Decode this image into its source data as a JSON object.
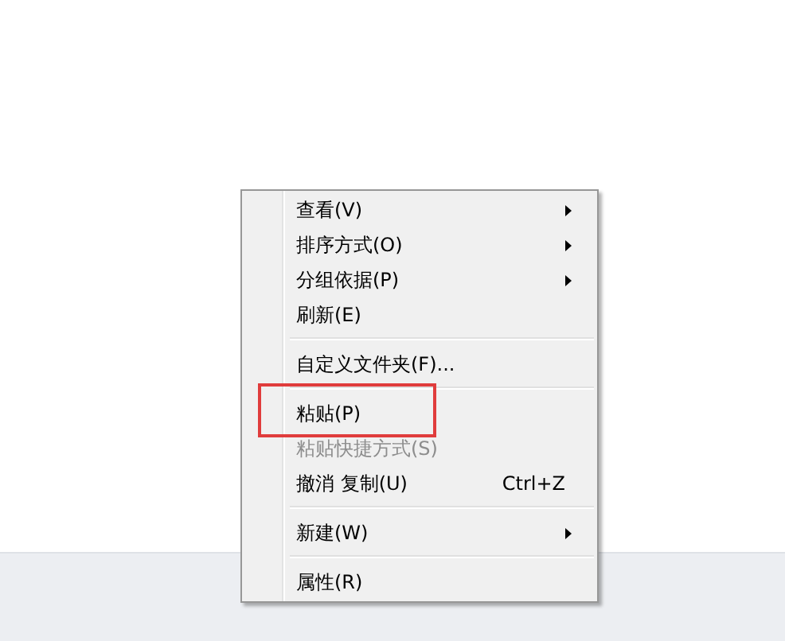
{
  "context_menu": {
    "groups": [
      [
        {
          "label": "查看(V)",
          "submenu": true,
          "disabled": false,
          "highlighted": false
        },
        {
          "label": "排序方式(O)",
          "submenu": true,
          "disabled": false,
          "highlighted": false
        },
        {
          "label": "分组依据(P)",
          "submenu": true,
          "disabled": false,
          "highlighted": false
        },
        {
          "label": "刷新(E)",
          "submenu": false,
          "disabled": false,
          "highlighted": false
        }
      ],
      [
        {
          "label": "自定义文件夹(F)...",
          "submenu": false,
          "disabled": false,
          "highlighted": false
        }
      ],
      [
        {
          "label": "粘贴(P)",
          "submenu": false,
          "disabled": false,
          "highlighted": true
        },
        {
          "label": "粘贴快捷方式(S)",
          "submenu": false,
          "disabled": true,
          "highlighted": false
        },
        {
          "label": "撤消 复制(U)",
          "shortcut": "Ctrl+Z",
          "submenu": false,
          "disabled": false,
          "highlighted": false
        }
      ],
      [
        {
          "label": "新建(W)",
          "submenu": true,
          "disabled": false,
          "highlighted": false
        }
      ],
      [
        {
          "label": "属性(R)",
          "submenu": false,
          "disabled": false,
          "highlighted": false
        }
      ]
    ]
  }
}
